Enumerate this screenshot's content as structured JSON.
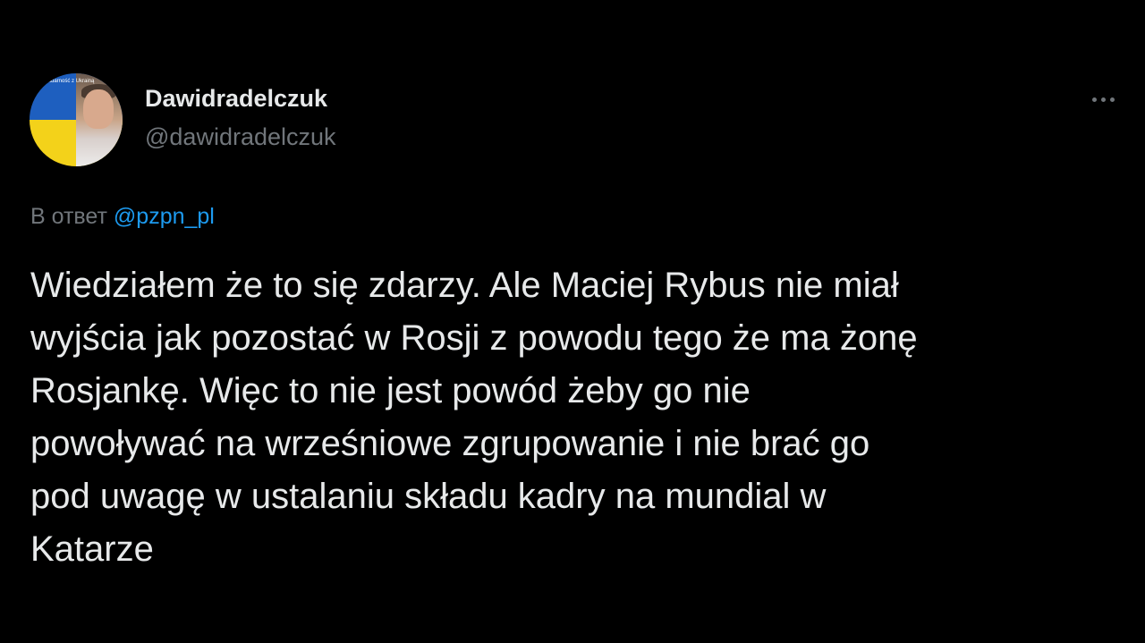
{
  "author": {
    "display_name": "Dawidradelczuk",
    "handle": "@dawidradelczuk",
    "avatar_banner_text": "Solidarność z Ukrainą"
  },
  "reply": {
    "prefix": "В ответ",
    "mention": "@pzpn_pl"
  },
  "tweet": {
    "text": "Wiedziałem że to się zdarzy. Ale Maciej Rybus nie miał\nwyjścia jak pozostać w Rosji z powodu tego że ma żonę\nRosjankę. Więc to nie jest powód żeby go nie\npowoływać na wrześniowe zgrupowanie i nie brać go\npod uwagę w ustalaniu składu kadry na mundial w\nKatarze"
  },
  "icons": {
    "more": "more-horizontal-icon"
  },
  "colors": {
    "background": "#000000",
    "primary_text": "#e7e9ea",
    "secondary_text": "#71767b",
    "link": "#1d9bf0",
    "flag_blue": "#1e5fbf",
    "flag_yellow": "#f3d21a"
  }
}
